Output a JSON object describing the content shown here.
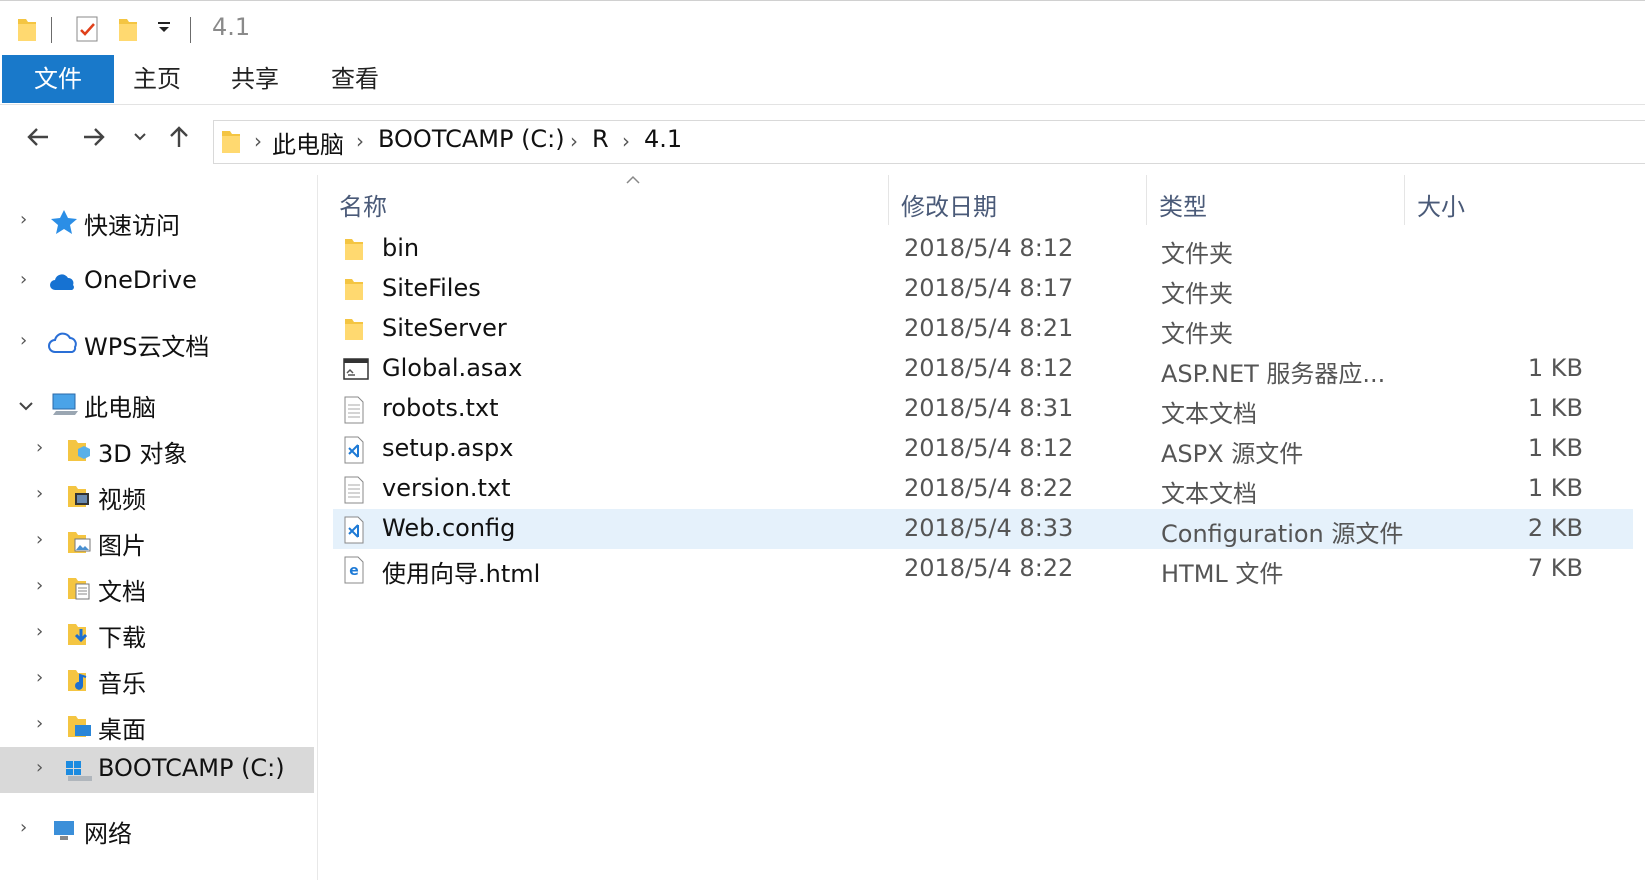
{
  "window": {
    "title": "4.1"
  },
  "ribbon": {
    "tabs": [
      {
        "label": "文件",
        "active": true
      },
      {
        "label": "主页"
      },
      {
        "label": "共享"
      },
      {
        "label": "查看"
      }
    ],
    "accent": "#1979ca"
  },
  "address": {
    "crumbs": [
      "此电脑",
      "BOOTCAMP (C:)",
      "R",
      "4.1"
    ]
  },
  "sidebar": {
    "items": [
      {
        "label": "快速访问",
        "icon": "star-icon",
        "level": 0,
        "expanded": false
      },
      {
        "label": "OneDrive",
        "icon": "cloud-icon",
        "level": 0,
        "expanded": false
      },
      {
        "label": "WPS云文档",
        "icon": "wps-cloud-icon",
        "level": 0,
        "expanded": false
      },
      {
        "label": "此电脑",
        "icon": "computer-icon",
        "level": 0,
        "expanded": true
      },
      {
        "label": "3D 对象",
        "icon": "3d-objects-icon",
        "level": 1
      },
      {
        "label": "视频",
        "icon": "videos-folder-icon",
        "level": 1
      },
      {
        "label": "图片",
        "icon": "pictures-folder-icon",
        "level": 1
      },
      {
        "label": "文档",
        "icon": "documents-folder-icon",
        "level": 1
      },
      {
        "label": "下载",
        "icon": "downloads-folder-icon",
        "level": 1
      },
      {
        "label": "音乐",
        "icon": "music-folder-icon",
        "level": 1
      },
      {
        "label": "桌面",
        "icon": "desktop-folder-icon",
        "level": 1
      },
      {
        "label": "BOOTCAMP (C:)",
        "icon": "drive-icon",
        "level": 1,
        "selected": true
      },
      {
        "label": "网络",
        "icon": "network-icon",
        "level": 0
      }
    ]
  },
  "columns": {
    "name": "名称",
    "date": "修改日期",
    "type": "类型",
    "size": "大小"
  },
  "files": [
    {
      "name": "bin",
      "date": "2018/5/4 8:12",
      "type": "文件夹",
      "size": "",
      "icon": "folder-icon"
    },
    {
      "name": "SiteFiles",
      "date": "2018/5/4 8:17",
      "type": "文件夹",
      "size": "",
      "icon": "folder-icon"
    },
    {
      "name": "SiteServer",
      "date": "2018/5/4 8:21",
      "type": "文件夹",
      "size": "",
      "icon": "folder-icon"
    },
    {
      "name": "Global.asax",
      "date": "2018/5/4 8:12",
      "type": "ASP.NET 服务器应...",
      "size": "1 KB",
      "icon": "asax-file-icon"
    },
    {
      "name": "robots.txt",
      "date": "2018/5/4 8:31",
      "type": "文本文档",
      "size": "1 KB",
      "icon": "text-file-icon"
    },
    {
      "name": "setup.aspx",
      "date": "2018/5/4 8:12",
      "type": "ASPX 源文件",
      "size": "1 KB",
      "icon": "vscode-file-icon"
    },
    {
      "name": "version.txt",
      "date": "2018/5/4 8:22",
      "type": "文本文档",
      "size": "1 KB",
      "icon": "text-file-icon"
    },
    {
      "name": "Web.config",
      "date": "2018/5/4 8:33",
      "type": "Configuration 源文件",
      "size": "2 KB",
      "icon": "vscode-file-icon",
      "selected": true
    },
    {
      "name": "使用向导.html",
      "date": "2018/5/4 8:22",
      "type": "HTML 文件",
      "size": "7 KB",
      "icon": "edge-html-icon"
    }
  ]
}
